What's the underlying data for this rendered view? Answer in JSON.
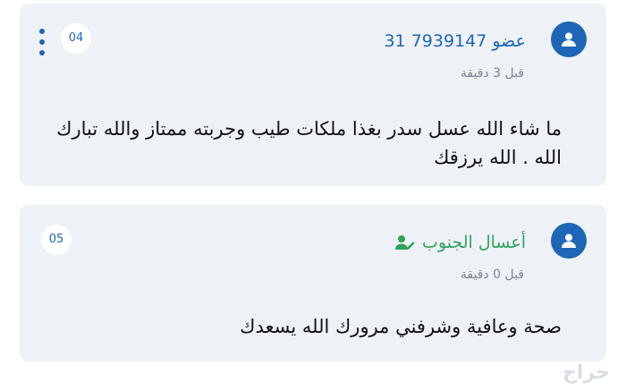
{
  "comments": [
    {
      "author": "عضو 7939147 31",
      "time": "قبل 3 دقيقة",
      "body": "ما شاء الله عسل سدر بغذا ملكات طيب وجربته ممتاز والله تبارك الله . الله يرزقك",
      "number": "04"
    },
    {
      "author": "أعسال الجنوب",
      "time": "قبل 0 دقيقة",
      "body": "صحة وعافية وشرفني مرورك الله يسعدك",
      "number": "05"
    }
  ],
  "colors": {
    "accent": "#1d67b6",
    "verified": "#2fa45b",
    "card_bg": "#eef1f6"
  },
  "watermark": "حراج"
}
